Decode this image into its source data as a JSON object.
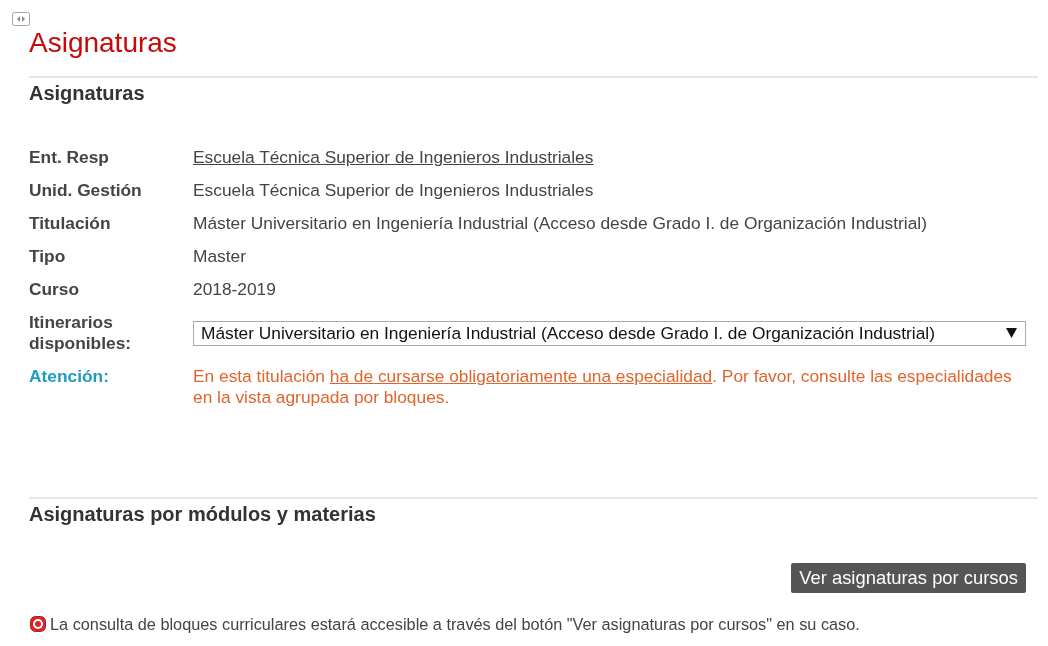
{
  "page": {
    "title": "Asignaturas"
  },
  "details": {
    "heading": "Asignaturas",
    "fields": [
      {
        "kind": "link",
        "label": "Ent. Resp",
        "value": "Escuela Técnica Superior de Ingenieros Industriales"
      },
      {
        "kind": "text",
        "label": "Unid. Gestión",
        "value": "Escuela Técnica Superior de Ingenieros Industriales"
      },
      {
        "kind": "text",
        "label": "Titulación",
        "value": "Máster Universitario en Ingeniería Industrial (Acceso desde Grado I. de Organización Industrial)"
      },
      {
        "kind": "text",
        "label": "Tipo",
        "value": "Master"
      },
      {
        "kind": "text",
        "label": "Curso",
        "value": "2018-2019"
      },
      {
        "kind": "select",
        "label": "Itinerarios disponibles:",
        "value": "Máster Universitario en Ingeniería Industrial (Acceso desde Grado I. de Organización Industrial)"
      },
      {
        "kind": "notice",
        "label": "Atención:",
        "text_before": "En esta titulación ",
        "link": "ha de cursarse obligatoriamente una especialidad",
        "text_after": ". Por favor, consulte las especialidades en la vista agrupada por bloques."
      }
    ]
  },
  "modules": {
    "heading": "Asignaturas por módulos y materias",
    "button": "Ver asignaturas por cursos",
    "note": "La consulta de bloques curriculares estará accesible a través del botón \"Ver asignaturas por cursos\" en su caso."
  }
}
